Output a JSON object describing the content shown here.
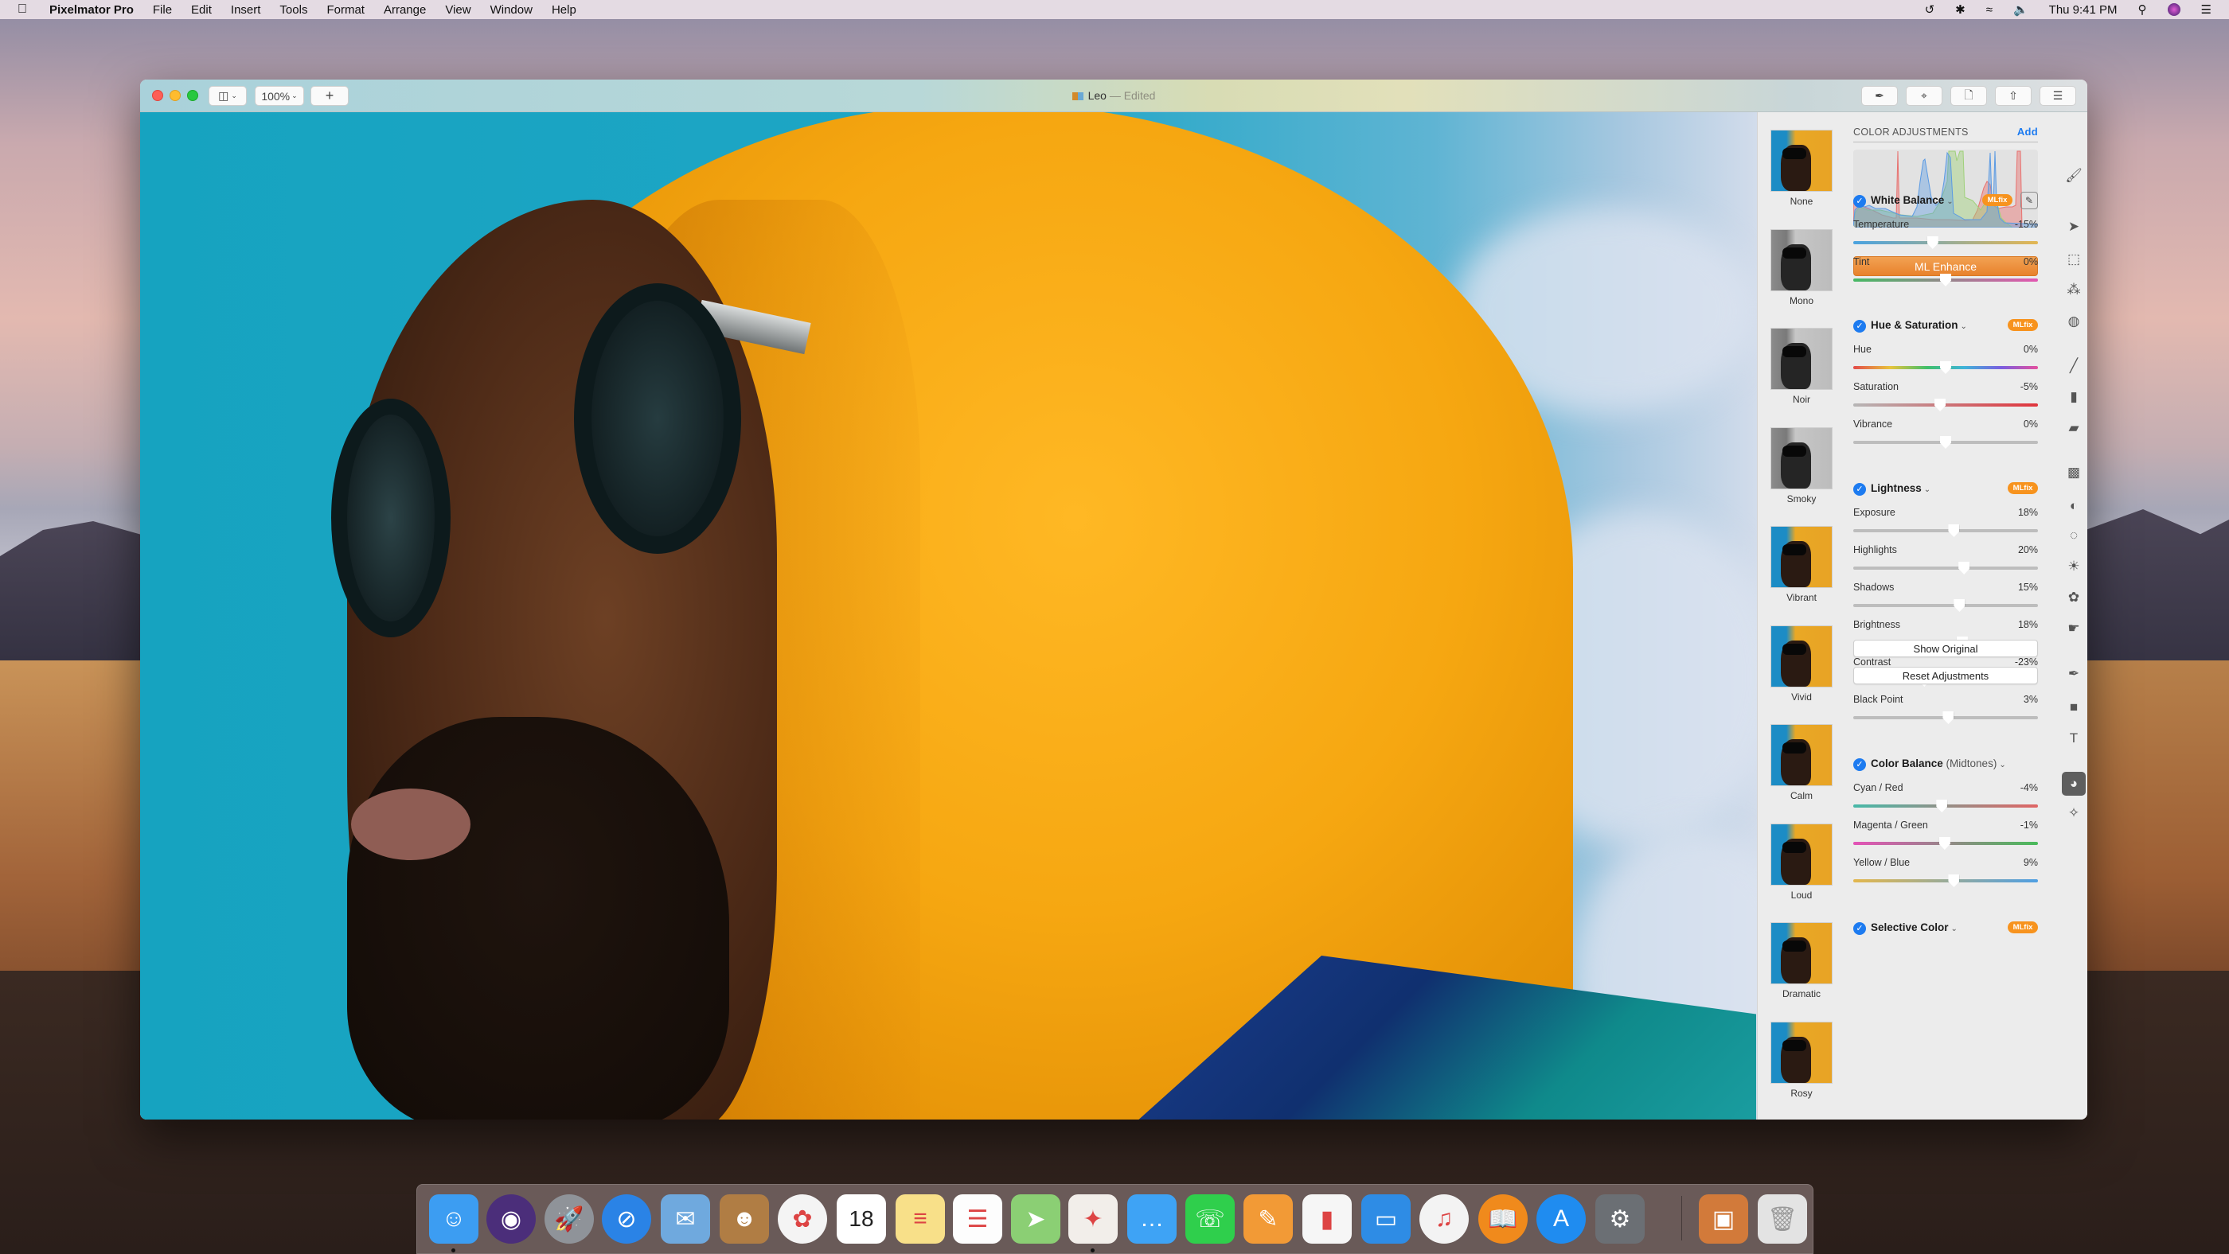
{
  "menubar": {
    "apple_icon": "apple-logo",
    "app_name": "Pixelmator Pro",
    "menus": [
      "File",
      "Edit",
      "Insert",
      "Tools",
      "Format",
      "Arrange",
      "View",
      "Window",
      "Help"
    ],
    "status_icons": [
      "time-machine-icon",
      "bluetooth-icon",
      "wifi-icon",
      "volume-icon"
    ],
    "clock": "Thu 9:41 PM",
    "right_icons": [
      "spotlight-icon",
      "siri-icon",
      "notification-center-icon"
    ]
  },
  "window": {
    "title": "Leo",
    "title_separator": " — ",
    "title_status": "Edited",
    "toolbar_left": {
      "view_button_icon": "sidebar-view-icon",
      "zoom_label": "100%",
      "add_label": "+"
    },
    "toolbar_right": [
      "markup-brush-icon",
      "crop-icon",
      "document-icon",
      "share-icon",
      "adjustments-sliders-icon"
    ]
  },
  "presets": [
    {
      "label": "None",
      "style": "color"
    },
    {
      "label": "Mono",
      "style": "gray"
    },
    {
      "label": "Noir",
      "style": "gray"
    },
    {
      "label": "Smoky",
      "style": "gray"
    },
    {
      "label": "Vibrant",
      "style": "color"
    },
    {
      "label": "Vivid",
      "style": "color"
    },
    {
      "label": "Calm",
      "style": "color"
    },
    {
      "label": "Loud",
      "style": "color"
    },
    {
      "label": "Dramatic",
      "style": "color"
    },
    {
      "label": "Rosy",
      "style": "color"
    }
  ],
  "color_adjustments": {
    "header": "COLOR ADJUSTMENTS",
    "add_label": "Add",
    "ml_enhance_label": "ML Enhance",
    "mlfix_label": "MLfix",
    "histogram_colors": {
      "red": "#e8716f",
      "green": "#9fd07a",
      "blue": "#5b9ae3",
      "gray": "#a9a9a9"
    },
    "sections": [
      {
        "title": "White Balance",
        "enabled": true,
        "mlfix": true,
        "picker": true,
        "sliders": [
          {
            "label": "Temperature",
            "value": "-15%",
            "fraction": 0.43,
            "gradient": [
              "#4aa3e0",
              "#e3b653"
            ]
          },
          {
            "label": "Tint",
            "value": "0%",
            "fraction": 0.5,
            "gradient": [
              "#46b964",
              "#e257b1"
            ]
          }
        ]
      },
      {
        "title": "Hue & Saturation",
        "enabled": true,
        "mlfix": true,
        "sliders": [
          {
            "label": "Hue",
            "value": "0%",
            "fraction": 0.5,
            "gradient": [
              "#e34a4a",
              "#e8c43c",
              "#3fbf6a",
              "#3fb4d9",
              "#7a5ee0",
              "#e5509e"
            ]
          },
          {
            "label": "Saturation",
            "value": "-5%",
            "fraction": 0.47,
            "gradient": [
              "#b6b6b6",
              "#e0343c"
            ]
          },
          {
            "label": "Vibrance",
            "value": "0%",
            "fraction": 0.5,
            "gradient": [
              "#bdbdbd",
              "#bdbdbd"
            ]
          }
        ]
      },
      {
        "title": "Lightness",
        "enabled": true,
        "mlfix": true,
        "sliders": [
          {
            "label": "Exposure",
            "value": "18%",
            "fraction": 0.545
          },
          {
            "label": "Highlights",
            "value": "20%",
            "fraction": 0.6
          },
          {
            "label": "Shadows",
            "value": "15%",
            "fraction": 0.575
          },
          {
            "label": "Brightness",
            "value": "18%",
            "fraction": 0.59
          },
          {
            "label": "Contrast",
            "value": "-23%",
            "fraction": 0.385
          },
          {
            "label": "Black Point",
            "value": "3%",
            "fraction": 0.515
          }
        ]
      },
      {
        "title": "Color Balance",
        "subtitle": "(Midtones)",
        "enabled": true,
        "mlfix": false,
        "sliders": [
          {
            "label": "Cyan / Red",
            "value": "-4%",
            "fraction": 0.48,
            "gradient": [
              "#47b9a8",
              "#e06565"
            ]
          },
          {
            "label": "Magenta / Green",
            "value": "-1%",
            "fraction": 0.495,
            "gradient": [
              "#e452b7",
              "#48bb5a"
            ]
          },
          {
            "label": "Yellow / Blue",
            "value": "9%",
            "fraction": 0.545,
            "gradient": [
              "#e3b74d",
              "#4f9fe3"
            ]
          }
        ]
      },
      {
        "title": "Selective Color",
        "enabled": true,
        "mlfix": true,
        "sliders": []
      }
    ],
    "show_original_label": "Show Original",
    "reset_label": "Reset Adjustments"
  },
  "tools": [
    "style-brush-icon",
    "arrange-pointer-icon",
    "rect-select-icon",
    "magic-select-icon",
    "quick-select-icon",
    "paint-brush-icon",
    "paint-bucket-icon",
    "eraser-icon",
    "repair-bandage-icon",
    "clone-icon",
    "blur-icon",
    "lighten-icon",
    "sponge-icon",
    "warp-icon",
    "pen-icon",
    "shape-icon",
    "type-icon",
    "color-adjust-icon",
    "effects-icon"
  ],
  "active_tool": "color-adjust-icon",
  "dock": [
    {
      "name": "finder",
      "glyph": "☺",
      "bg": "#3c9df2",
      "running": true
    },
    {
      "name": "siri",
      "glyph": "◉",
      "bg": "#4b2e7a",
      "running": false
    },
    {
      "name": "launchpad",
      "glyph": "🚀",
      "bg": "#8f9399",
      "running": false
    },
    {
      "name": "safari",
      "glyph": "⊘",
      "bg": "#2a83e6",
      "running": false
    },
    {
      "name": "mail",
      "glyph": "✉",
      "bg": "#6fa9de",
      "running": false
    },
    {
      "name": "contacts",
      "glyph": "☻",
      "bg": "#b07d44",
      "running": false
    },
    {
      "name": "photos",
      "glyph": "✿",
      "bg": "#f4f4f4",
      "running": false
    },
    {
      "name": "calendar",
      "glyph": "18",
      "bg": "#ffffff",
      "running": false
    },
    {
      "name": "notes",
      "glyph": "≡",
      "bg": "#f8e089",
      "running": false
    },
    {
      "name": "reminders",
      "glyph": "☰",
      "bg": "#fdfdfd",
      "running": false
    },
    {
      "name": "maps",
      "glyph": "➤",
      "bg": "#8bcf74",
      "running": false
    },
    {
      "name": "pixelmator-pro",
      "glyph": "✦",
      "bg": "#f2eeea",
      "running": true
    },
    {
      "name": "messages",
      "glyph": "…",
      "bg": "#3ea3f5",
      "running": false
    },
    {
      "name": "facetime",
      "glyph": "☏",
      "bg": "#2fcf4c",
      "running": false
    },
    {
      "name": "pages",
      "glyph": "✎",
      "bg": "#f29a36",
      "running": false
    },
    {
      "name": "numbers",
      "glyph": "▮",
      "bg": "#f6f6f6",
      "running": false
    },
    {
      "name": "keynote",
      "glyph": "▭",
      "bg": "#2e8ce5",
      "running": false
    },
    {
      "name": "itunes",
      "glyph": "♫",
      "bg": "#f3f3f3",
      "running": false
    },
    {
      "name": "ibooks",
      "glyph": "📖",
      "bg": "#f08a1c",
      "running": false
    },
    {
      "name": "app-store",
      "glyph": "A",
      "bg": "#1f8cf0",
      "running": false
    },
    {
      "name": "system-preferences",
      "glyph": "⚙",
      "bg": "#6b6f74",
      "running": false
    },
    {
      "name": "downloads-stack",
      "glyph": "▣",
      "bg": "#d27a3a",
      "running": false
    },
    {
      "name": "trash",
      "glyph": "🗑",
      "bg": "#e3e3e3",
      "running": false
    }
  ]
}
